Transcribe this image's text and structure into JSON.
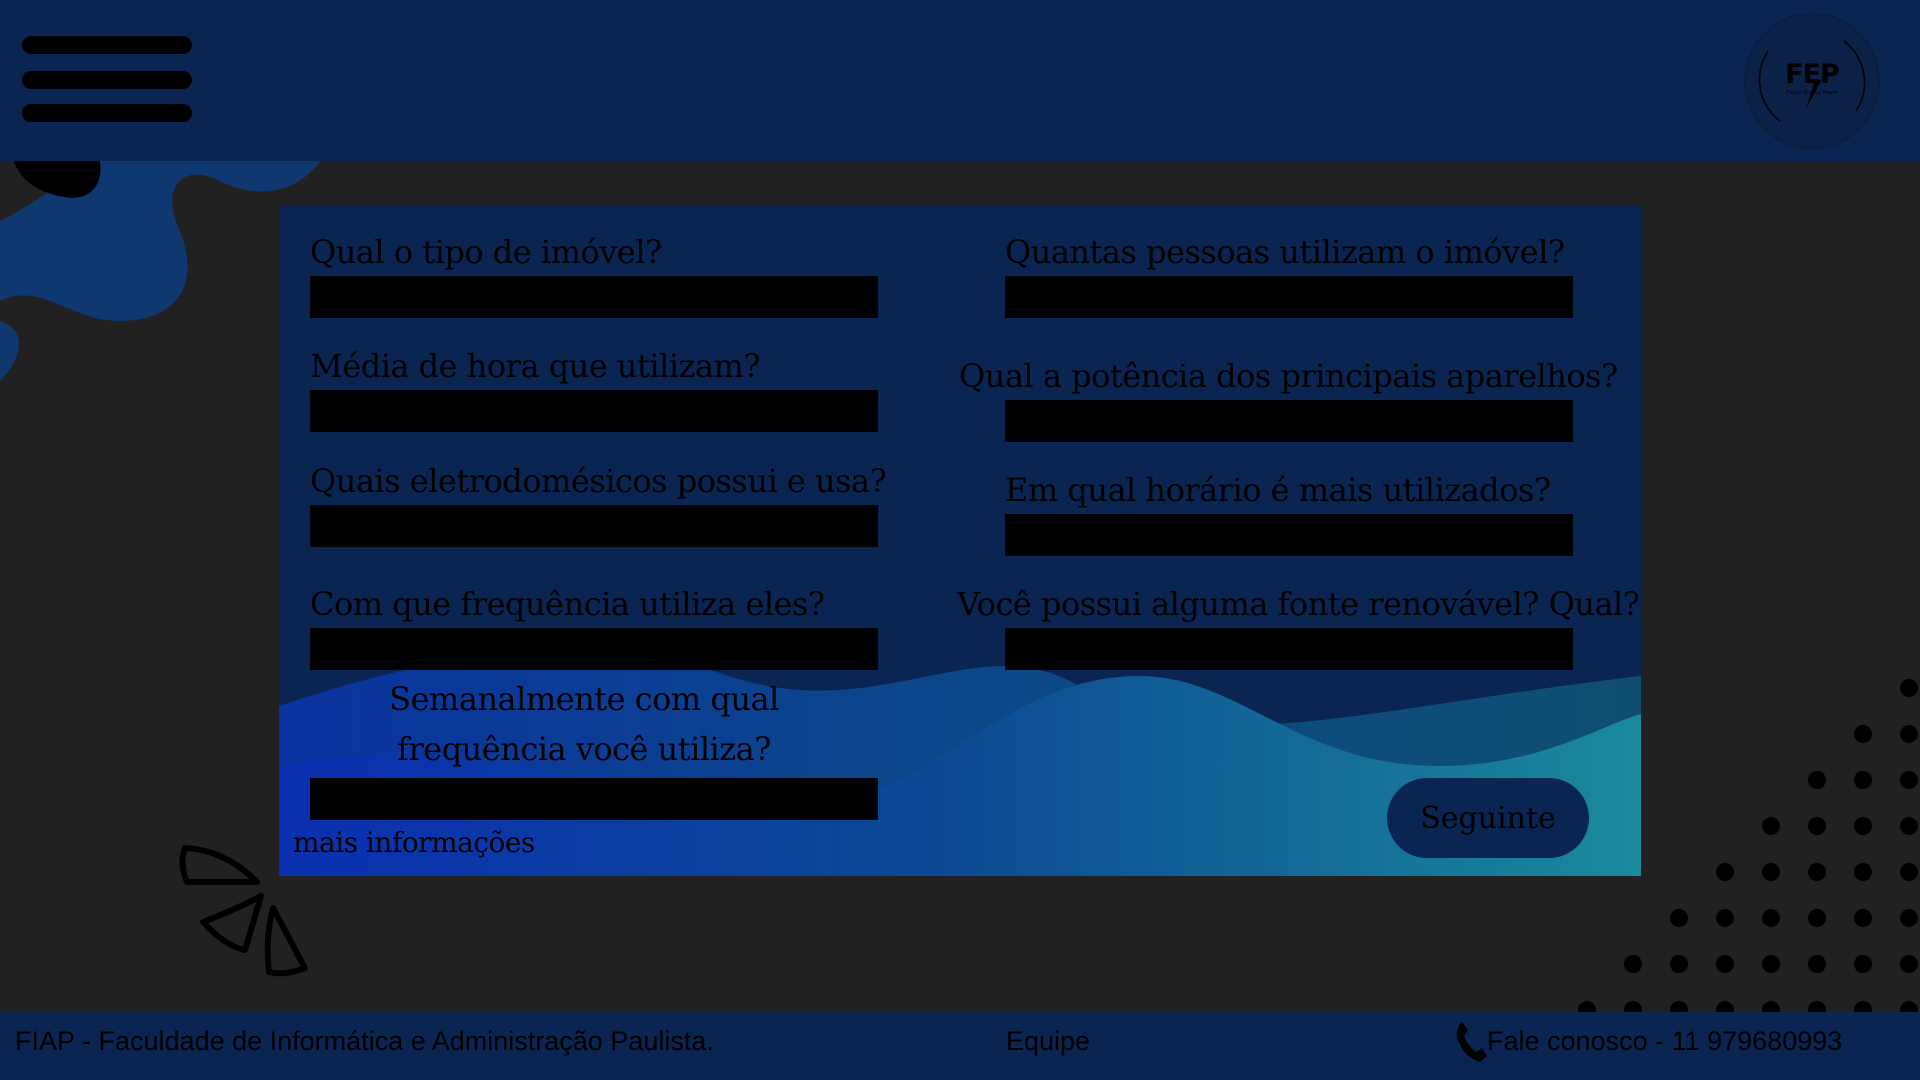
{
  "header": {
    "menu_icon": "hamburger-menu-icon",
    "logo": {
      "text": "FEP",
      "subtext": "Future Energy Power"
    }
  },
  "form": {
    "questions_left": [
      "Qual o tipo de imóvel?",
      "Média de hora que utilizam?",
      "Quais eletrodomésicos possui e usa?",
      "Com que frequência utiliza eles?"
    ],
    "questions_right": [
      "Quantas pessoas utilizam o imóvel?",
      "Qual a potência dos principais aparelhos?",
      "Em qual horário é mais utilizados?",
      "Você possui alguma fonte renovável? Qual?"
    ],
    "weekly_question": "Semanalmente com qual frequência você utiliza?",
    "more_info_link": "mais informações",
    "next_button": "Seguinte"
  },
  "footer": {
    "institution": "FIAP - Faculdade de Informática e Administração Paulista.",
    "team_link": "Equipe",
    "phone_icon": "phone-icon",
    "contact": "Fale conosco - 11 979680993"
  },
  "colors": {
    "background": "#212121",
    "header": "#0a2551",
    "card": "#0a2551",
    "field": "#000000"
  }
}
